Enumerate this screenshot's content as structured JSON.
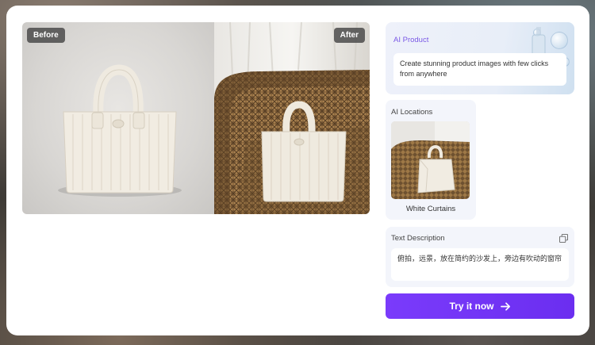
{
  "compare": {
    "before_label": "Before",
    "after_label": "After"
  },
  "ai_product": {
    "title": "AI Product",
    "description": "Create stunning product images with few clicks from anywhere"
  },
  "ai_locations": {
    "title": "AI Locations",
    "items": [
      {
        "label": "White Curtains"
      }
    ]
  },
  "text_description": {
    "title": "Text Description",
    "value": "俯拍，远景，放在简约的沙发上，旁边有吹动的窗帘"
  },
  "cta": {
    "label": "Try it now"
  },
  "colors": {
    "accent": "#7a3bfb",
    "product_title": "#7a58e6"
  },
  "icons": [
    "copy-icon",
    "arrow-right-icon"
  ]
}
